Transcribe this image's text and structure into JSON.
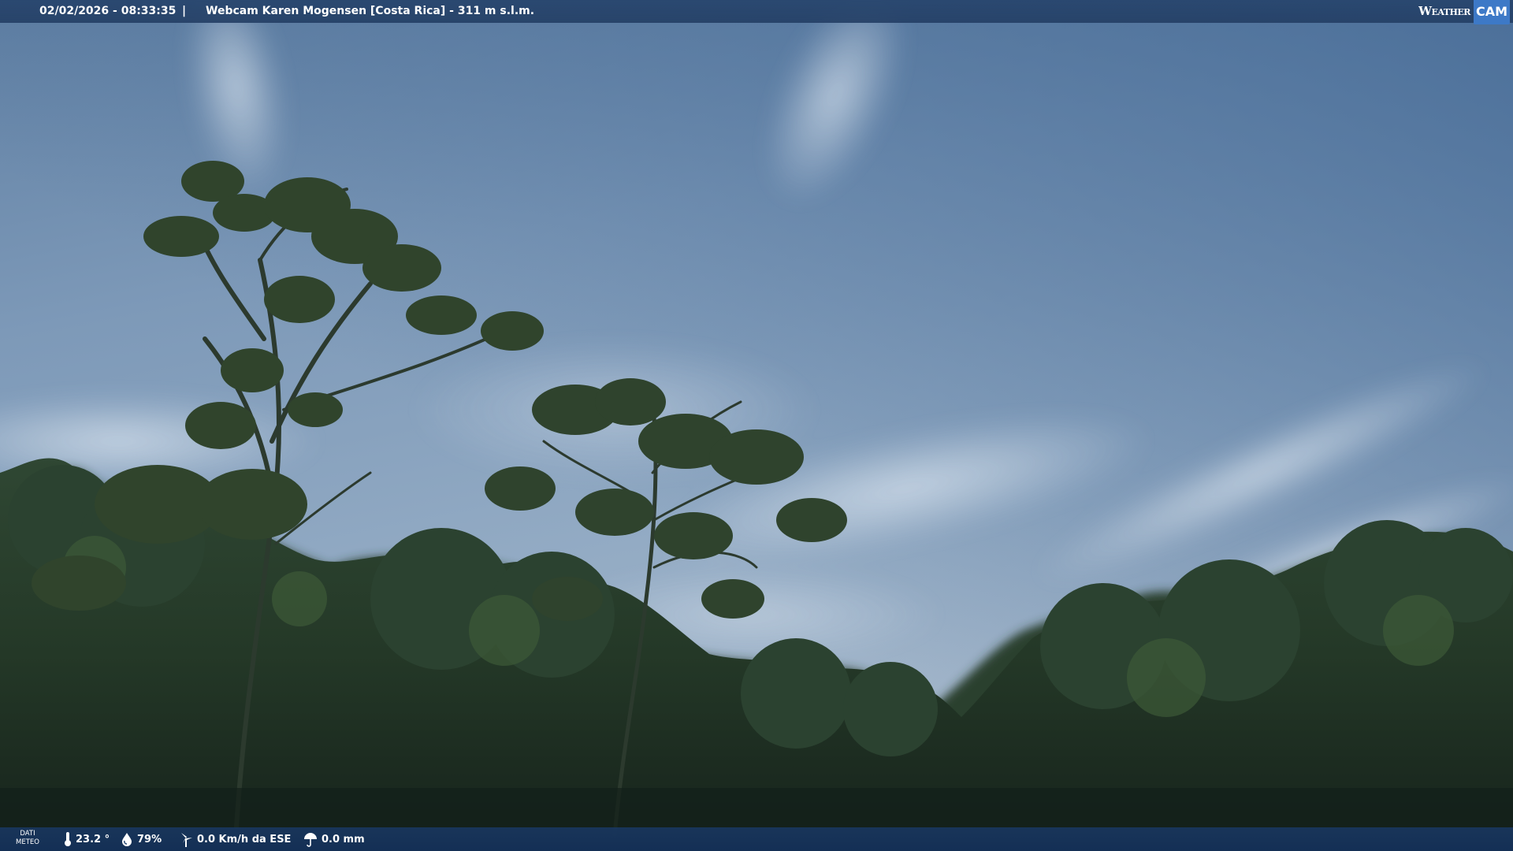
{
  "header": {
    "datetime": "02/02/2026 - 08:33:35",
    "separator": "|",
    "title": "Webcam Karen Mogensen [Costa Rica]  - 311 m s.l.m.",
    "logo_text_1": "Weather",
    "logo_text_2": "CAM"
  },
  "footer": {
    "dati_line1": "DATI",
    "dati_line2": "METEO",
    "temperature": "23.2 °",
    "humidity": "79%",
    "wind": "0.0 Km/h da ESE",
    "rain": "0.0 mm"
  },
  "icons": {
    "temperature": "thermometer-icon",
    "humidity": "humidity-drop-icon",
    "wind": "wind-turbine-icon",
    "rain": "rain-umbrella-icon"
  },
  "colors": {
    "sky_top": "#4e6f94",
    "sky_mid": "#7d99b8",
    "sky_horizon": "#9bb0c6",
    "foliage_dark": "#1c2a22",
    "foliage_mid": "#2e4530",
    "bar": "#2a4a74"
  }
}
